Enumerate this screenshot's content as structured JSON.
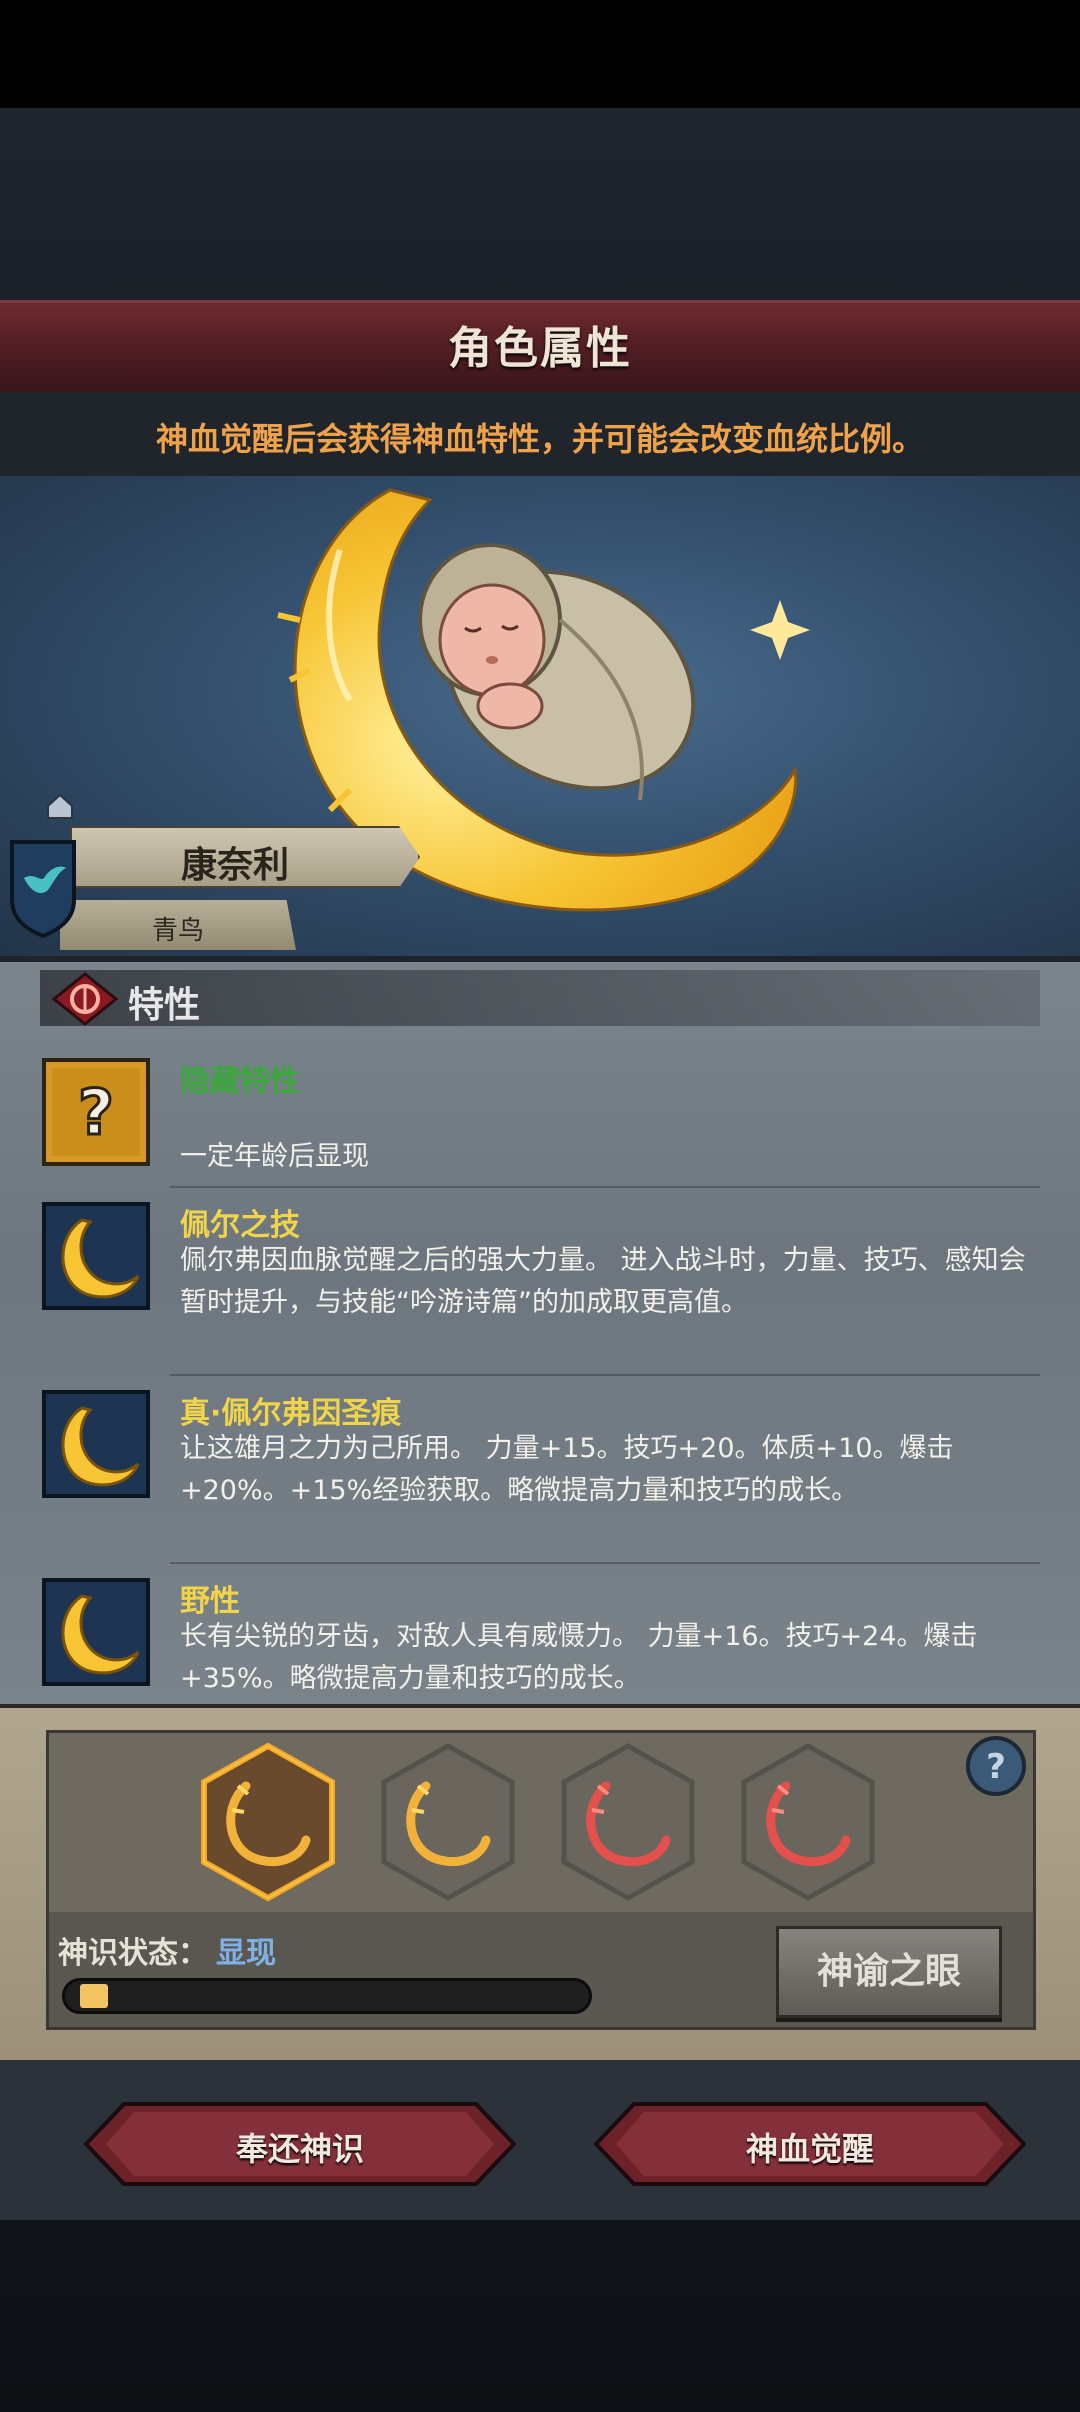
{
  "header": {
    "title": "角色属性",
    "subtitle": "神血觉醒后会获得神血特性，并可能会改变血统比例。"
  },
  "character": {
    "name": "康奈利",
    "lineage": "青鸟"
  },
  "traits": {
    "header": "特性",
    "items": [
      {
        "name": "隐藏特性",
        "desc": "一定年龄后显现",
        "name_color": "#3aa83a",
        "icon": "question-icon"
      },
      {
        "name": "佩尔之技",
        "desc": "佩尔弗因血脉觉醒之后的强大力量。 进入战斗时，力量、技巧、感知会暂时提升，与技能“吟游诗篇”的加成取更高值。",
        "name_color": "#f0d44a",
        "icon": "crescent-moon-icon"
      },
      {
        "name": "真·佩尔弗因圣痕",
        "desc": "让这雄月之力为己所用。 力量+15。技巧+20。体质+10。爆击+20%。+15%经验获取。略微提高力量和技巧的成长。",
        "name_color": "#f0d44a",
        "icon": "crescent-moon-icon"
      },
      {
        "name": "野性",
        "desc": "长有尖锐的牙齿，对敌人具有威慑力。 力量+16。技巧+24。爆击+35%。略微提高力量和技巧的成长。",
        "name_color": "#f0d44a",
        "icon": "crescent-moon-icon"
      }
    ]
  },
  "divine": {
    "slots": [
      {
        "icon": "gold-crescent-icon",
        "selected": true,
        "color": "#f2b23a"
      },
      {
        "icon": "gold-crescent-icon",
        "selected": false,
        "color": "#f2b23a"
      },
      {
        "icon": "red-crescent-icon",
        "selected": false,
        "color": "#e4504c"
      },
      {
        "icon": "red-crescent-icon",
        "selected": false,
        "color": "#e4504c"
      }
    ],
    "status_label": "神识状态：",
    "status_value": "显现",
    "progress": 0.055,
    "oracle_button": "神谕之眼"
  },
  "actions": {
    "return_label": "奉还神识",
    "awaken_label": "神血觉醒"
  },
  "colors": {
    "accent_orange": "#f0a24a",
    "banner_red": "#5a2128",
    "gold": "#f7c534"
  }
}
